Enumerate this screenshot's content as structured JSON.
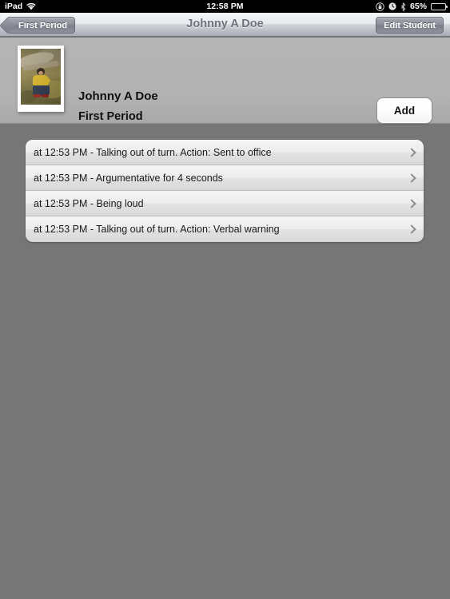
{
  "status_bar": {
    "carrier": "iPad",
    "wifi_icon": "wifi-icon",
    "time": "12:58 PM",
    "rotation_lock_icon": "rotation-lock-icon",
    "alarm_icon": "alarm-clock-icon",
    "bluetooth_icon": "bluetooth-icon",
    "battery_percent": "65%",
    "battery_icon": "battery-icon",
    "battery_level": 65
  },
  "nav_bar": {
    "back_label": "First Period",
    "title": "Johnny A Doe",
    "edit_label": "Edit Student"
  },
  "header": {
    "photo_icon": "student-photo",
    "student_name": "Johnny A Doe",
    "period": "First Period",
    "add_label": "Add"
  },
  "incidents": [
    {
      "text": "at 12:53 PM - Talking out of turn.  Action: Sent to office",
      "chevron": "chevron-right-icon"
    },
    {
      "text": "at 12:53 PM - Argumentative for 4 seconds",
      "chevron": "chevron-right-icon"
    },
    {
      "text": "at 12:53 PM - Being loud",
      "chevron": "chevron-right-icon"
    },
    {
      "text": "at 12:53 PM - Talking out of turn.  Action: Verbal warning",
      "chevron": "chevron-right-icon"
    }
  ],
  "colors": {
    "status_bar_bg": "#000000",
    "nav_bar_top": "#f6f7f9",
    "nav_bar_bottom": "#a9abb5",
    "header_bg": "#b4b4b4",
    "body_bg": "#767676",
    "row_bg": "#ededed",
    "title_text": "#6f727b"
  }
}
